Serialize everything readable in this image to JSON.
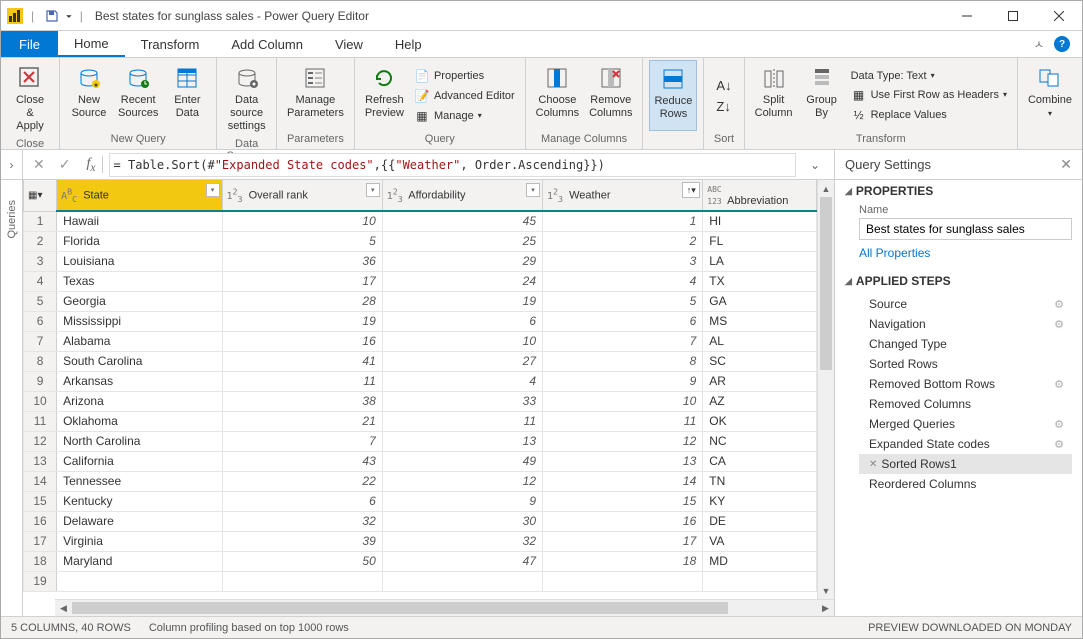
{
  "title_bar": {
    "title": "Best states for sunglass sales - Power Query Editor"
  },
  "menu": {
    "file": "File",
    "home": "Home",
    "transform": "Transform",
    "add_column": "Add Column",
    "view": "View",
    "help": "Help"
  },
  "ribbon": {
    "close": {
      "close_apply": "Close &\nApply",
      "group": "Close"
    },
    "new_query": {
      "new_source": "New\nSource",
      "recent_sources": "Recent\nSources",
      "enter_data": "Enter\nData",
      "group": "New Query"
    },
    "data_sources": {
      "data_source_settings": "Data source\nsettings",
      "group": "Data Sources"
    },
    "parameters": {
      "manage_parameters": "Manage\nParameters",
      "group": "Parameters"
    },
    "query": {
      "refresh_preview": "Refresh\nPreview",
      "properties": "Properties",
      "advanced_editor": "Advanced Editor",
      "manage": "Manage",
      "group": "Query"
    },
    "manage_columns": {
      "choose_columns": "Choose\nColumns",
      "remove_columns": "Remove\nColumns",
      "group": "Manage Columns"
    },
    "reduce_rows": {
      "reduce_rows": "Reduce\nRows",
      "group": ""
    },
    "sort": {
      "group": "Sort"
    },
    "transform": {
      "split_column": "Split\nColumn",
      "group_by": "Group\nBy",
      "data_type": "Data Type: Text",
      "first_row": "Use First Row as Headers",
      "replace_values": "Replace Values",
      "group": "Transform"
    },
    "combine": {
      "combine": "Combine",
      "group": ""
    }
  },
  "formula": "= Table.Sort(#\"Expanded State codes\",{{\"Weather\", Order.Ascending}})",
  "columns": [
    {
      "name": "State",
      "type": "ABC"
    },
    {
      "name": "Overall rank",
      "type": "123"
    },
    {
      "name": "Affordability",
      "type": "123"
    },
    {
      "name": "Weather",
      "type": "123",
      "sorted": true
    },
    {
      "name": "Abbreviation",
      "type": "ABC123"
    }
  ],
  "rows": [
    {
      "n": 1,
      "state": "Hawaii",
      "rank": 10,
      "afford": 45,
      "weather": 1,
      "abbr": "HI"
    },
    {
      "n": 2,
      "state": "Florida",
      "rank": 5,
      "afford": 25,
      "weather": 2,
      "abbr": "FL"
    },
    {
      "n": 3,
      "state": "Louisiana",
      "rank": 36,
      "afford": 29,
      "weather": 3,
      "abbr": "LA"
    },
    {
      "n": 4,
      "state": "Texas",
      "rank": 17,
      "afford": 24,
      "weather": 4,
      "abbr": "TX"
    },
    {
      "n": 5,
      "state": "Georgia",
      "rank": 28,
      "afford": 19,
      "weather": 5,
      "abbr": "GA"
    },
    {
      "n": 6,
      "state": "Mississippi",
      "rank": 19,
      "afford": 6,
      "weather": 6,
      "abbr": "MS"
    },
    {
      "n": 7,
      "state": "Alabama",
      "rank": 16,
      "afford": 10,
      "weather": 7,
      "abbr": "AL"
    },
    {
      "n": 8,
      "state": "South Carolina",
      "rank": 41,
      "afford": 27,
      "weather": 8,
      "abbr": "SC"
    },
    {
      "n": 9,
      "state": "Arkansas",
      "rank": 11,
      "afford": 4,
      "weather": 9,
      "abbr": "AR"
    },
    {
      "n": 10,
      "state": "Arizona",
      "rank": 38,
      "afford": 33,
      "weather": 10,
      "abbr": "AZ"
    },
    {
      "n": 11,
      "state": "Oklahoma",
      "rank": 21,
      "afford": 11,
      "weather": 11,
      "abbr": "OK"
    },
    {
      "n": 12,
      "state": "North Carolina",
      "rank": 7,
      "afford": 13,
      "weather": 12,
      "abbr": "NC"
    },
    {
      "n": 13,
      "state": "California",
      "rank": 43,
      "afford": 49,
      "weather": 13,
      "abbr": "CA"
    },
    {
      "n": 14,
      "state": "Tennessee",
      "rank": 22,
      "afford": 12,
      "weather": 14,
      "abbr": "TN"
    },
    {
      "n": 15,
      "state": "Kentucky",
      "rank": 6,
      "afford": 9,
      "weather": 15,
      "abbr": "KY"
    },
    {
      "n": 16,
      "state": "Delaware",
      "rank": 32,
      "afford": 30,
      "weather": 16,
      "abbr": "DE"
    },
    {
      "n": 17,
      "state": "Virginia",
      "rank": 39,
      "afford": 32,
      "weather": 17,
      "abbr": "VA"
    },
    {
      "n": 18,
      "state": "Maryland",
      "rank": 50,
      "afford": 47,
      "weather": 18,
      "abbr": "MD"
    },
    {
      "n": 19,
      "state": "",
      "rank": "",
      "afford": "",
      "weather": "",
      "abbr": ""
    }
  ],
  "settings": {
    "title": "Query Settings",
    "properties": "PROPERTIES",
    "name": "Name",
    "name_value": "Best states for sunglass sales",
    "all_properties": "All Properties",
    "applied_steps": "APPLIED STEPS",
    "steps": [
      "Source",
      "Navigation",
      "Changed Type",
      "Sorted Rows",
      "Removed Bottom Rows",
      "Removed Columns",
      "Merged Queries",
      "Expanded State codes",
      "Sorted Rows1",
      "Reordered Columns"
    ],
    "active_step": 8,
    "gear_steps": [
      0,
      1,
      4,
      6,
      7
    ]
  },
  "status": {
    "cols_rows": "5 COLUMNS, 40 ROWS",
    "profiling": "Column profiling based on top 1000 rows",
    "preview": "PREVIEW DOWNLOADED ON MONDAY"
  },
  "queries_label": "Queries"
}
